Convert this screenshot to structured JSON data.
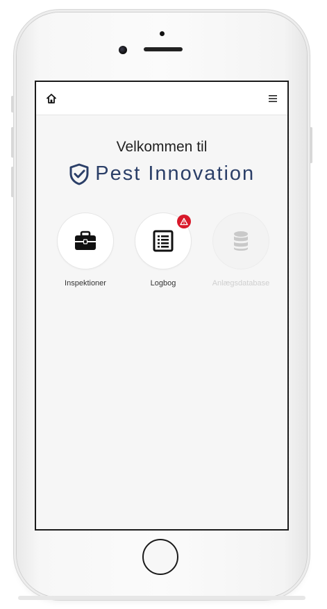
{
  "navbar": {
    "home_icon": "home-icon",
    "menu_icon": "hamburger-menu-icon"
  },
  "welcome": {
    "greeting": "Velkommen til",
    "brand_name": "Pest Innovation",
    "brand_logo": "shield-check-logo",
    "brand_color": "#2b3f68"
  },
  "tiles": [
    {
      "label": "Inspektioner",
      "icon": "briefcase-icon",
      "enabled": true
    },
    {
      "label": "Logbog",
      "icon": "list-document-icon",
      "enabled": true,
      "badge_icon": "warning-triangle-icon",
      "badge_color": "#d8192a"
    },
    {
      "label": "Anlægsdatabase",
      "icon": "database-icon",
      "enabled": false
    }
  ]
}
